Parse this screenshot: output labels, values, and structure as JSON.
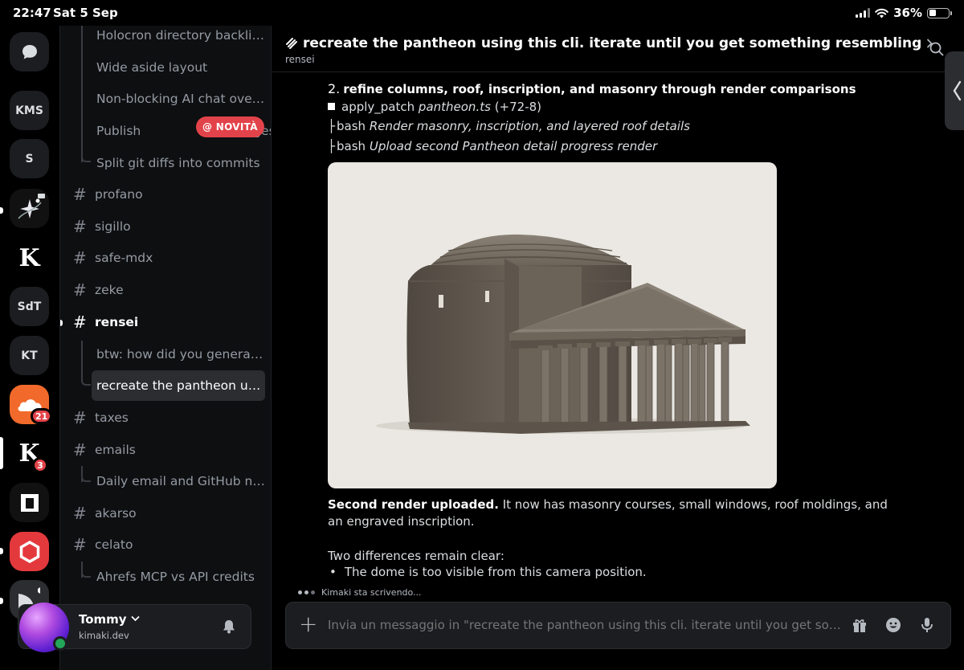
{
  "status_bar": {
    "time": "22:47",
    "date": "Sat 5 Sep",
    "battery": "36%",
    "battery_level": 0.36
  },
  "servers": [
    {
      "label": "",
      "icon": "chat-bubble-icon"
    },
    {
      "label": "KMS"
    },
    {
      "label": "S"
    },
    {
      "label": "",
      "icon": "sparkle-icon"
    },
    {
      "label": "K"
    },
    {
      "label": "SdT"
    },
    {
      "label": "KT"
    },
    {
      "label": "",
      "icon": "cloudflare-icon",
      "badge": "21"
    },
    {
      "label": "K",
      "badge": "3"
    },
    {
      "label": "",
      "icon": "square-icon"
    },
    {
      "label": "",
      "icon": "hexagon-icon"
    },
    {
      "label": "",
      "icon": "speaker-icon"
    }
  ],
  "channels": {
    "items": [
      {
        "type": "thread",
        "label": "Holocron directory backlinks"
      },
      {
        "type": "thread",
        "label": "Wide aside layout"
      },
      {
        "type": "thread",
        "label": "Non-blocking AI chat overlay"
      },
      {
        "type": "thread",
        "label": "Publish",
        "label_tail": "ackages"
      },
      {
        "type": "thread",
        "label": "Split git diffs into commits"
      },
      {
        "type": "channel",
        "label": "profano"
      },
      {
        "type": "channel",
        "label": "sigillo"
      },
      {
        "type": "channel",
        "label": "safe-mdx"
      },
      {
        "type": "channel",
        "label": "zeke"
      },
      {
        "type": "channel",
        "label": "rensei",
        "active": true
      },
      {
        "type": "thread",
        "label": "btw: how did you generate..."
      },
      {
        "type": "thread",
        "label": "recreate the pantheon usin...",
        "selected": true
      },
      {
        "type": "channel",
        "label": "taxes"
      },
      {
        "type": "channel",
        "label": "emails"
      },
      {
        "type": "thread",
        "label": "Daily email and GitHub noti..."
      },
      {
        "type": "channel",
        "label": "akarso"
      },
      {
        "type": "channel",
        "label": "celato"
      },
      {
        "type": "thread",
        "label": "Ahrefs MCP vs API credits"
      }
    ],
    "novita_badge": "@ NOVITÀ"
  },
  "user": {
    "name": "Tommy",
    "handle": "kimaki.dev"
  },
  "header": {
    "title": "recreate the pantheon using this cli. iterate until you get something resembling",
    "subtitle": "rensei"
  },
  "message": {
    "step_number": "2.",
    "step_title": "refine columns, roof, inscription, and masonry through render comparisons",
    "patch_label": "apply_patch",
    "patch_file": "pantheon.ts",
    "patch_diff": "(+72-8)",
    "bash1_label": "bash",
    "bash1_desc": "Render masonry, inscription, and layered roof details",
    "bash2_label": "bash",
    "bash2_desc": "Upload second Pantheon detail progress render",
    "para1_bold": "Second render uploaded.",
    "para1_rest": " It now has masonry courses, small windows, roof moldings, and an engraved inscription.",
    "para2": "Two differences remain clear:",
    "bullet1": "The dome is too visible from this camera position."
  },
  "typing": "Kimaki sta scrivendo...",
  "composer": {
    "placeholder": "Invia un messaggio in \"recreate the pantheon using this cli. iterate until you get something..."
  }
}
